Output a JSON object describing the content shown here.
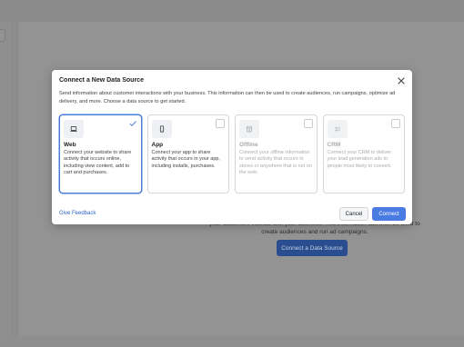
{
  "background": {
    "description_text": "your customers interact with your business. This information can then be used to create audiences and run ad campaigns.",
    "connect_button_label": "Connect a Data Source"
  },
  "modal": {
    "title": "Connect a New Data Source",
    "description": "Send information about customer interactions with your business. This information can then be used to create audiences, run campaigns, optimize ad delivery, and more. Choose a data source to get started.",
    "sources": [
      {
        "title": "Web",
        "description": "Connect your website to share activity that occurs online, including view content, add to cart and purchases.",
        "icon": "laptop-icon",
        "selected": true,
        "enabled": true
      },
      {
        "title": "App",
        "description": "Connect your app to share activity that occurs in your app, including installs, purchases.",
        "icon": "mobile-phone-icon",
        "selected": false,
        "enabled": true
      },
      {
        "title": "Offline",
        "description": "Connect your offline information to send activity that occurs in stores or anywhere that is not on the web.",
        "icon": "store-icon",
        "selected": false,
        "enabled": false
      },
      {
        "title": "CRM",
        "description": "Connect your CRM to deliver your lead generation ads to people most likely to convert.",
        "icon": "contact-card-icon",
        "selected": false,
        "enabled": false
      }
    ],
    "feedback_link": "Give Feedback",
    "cancel_label": "Cancel",
    "connect_label": "Connect"
  },
  "colors": {
    "accent": "#4a7be3",
    "link": "#2b5fc7",
    "selected_border": "#4a7bd8"
  }
}
